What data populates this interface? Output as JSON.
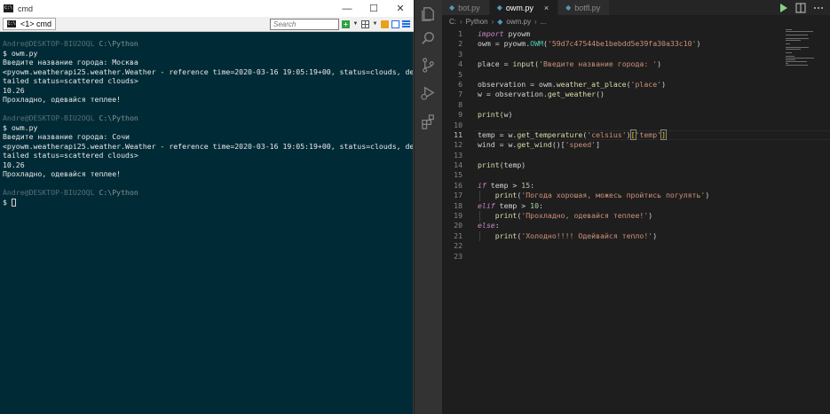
{
  "cmder": {
    "title": "cmd",
    "title_icon": "cmder-icon",
    "window_buttons": [
      "—",
      "☐",
      "✕"
    ],
    "tab_label": "<1> cmd",
    "search_placeholder": "Search",
    "prompt_user": "Andre@DESKTOP-BIU2OQL",
    "prompt_path": "C:\\Python",
    "lines": [
      {
        "type": "prompt"
      },
      {
        "type": "text",
        "text": "$ owm.py"
      },
      {
        "type": "text",
        "text": "Введите название города: Москва"
      },
      {
        "type": "text",
        "text": "<pyowm.weatherapi25.weather.Weather - reference time=2020-03-16 19:05:19+00, status=clouds, de"
      },
      {
        "type": "text",
        "text": "tailed status=scattered clouds>"
      },
      {
        "type": "text",
        "text": "10.26"
      },
      {
        "type": "text",
        "text": "Прохладно, одевайся теплее!"
      },
      {
        "type": "text",
        "text": ""
      },
      {
        "type": "prompt"
      },
      {
        "type": "text",
        "text": "$ owm.py"
      },
      {
        "type": "text",
        "text": "Введите название города: Сочи"
      },
      {
        "type": "text",
        "text": "<pyowm.weatherapi25.weather.Weather - reference time=2020-03-16 19:05:19+00, status=clouds, de"
      },
      {
        "type": "text",
        "text": "tailed status=scattered clouds>"
      },
      {
        "type": "text",
        "text": "10.26"
      },
      {
        "type": "text",
        "text": "Прохладно, одевайся теплее!"
      },
      {
        "type": "text",
        "text": ""
      },
      {
        "type": "prompt"
      },
      {
        "type": "cursor",
        "text": "$ "
      }
    ]
  },
  "vscode": {
    "tabs": [
      {
        "label": "bot.py",
        "active": false
      },
      {
        "label": "owm.py",
        "active": true
      },
      {
        "label": "botfl.py",
        "active": false
      }
    ],
    "tab_close": "×",
    "breadcrumb": [
      "C:",
      "Python",
      "owm.py",
      "..."
    ],
    "activity_icons": [
      "files-icon",
      "search-icon",
      "source-control-icon",
      "run-debug-icon",
      "extensions-icon"
    ],
    "editor_actions": [
      "run-icon",
      "split-editor-icon",
      "more-actions-icon"
    ],
    "current_line": 11,
    "code": [
      {
        "n": "1",
        "html": "<span class=\"kw\">import</span> pyowm"
      },
      {
        "n": "2",
        "html": "owm = pyowm.<span class=\"cls\">OWM</span>(<span class=\"st\">'59d7c47544be1bebdd5e39fa30a33c10'</span>)"
      },
      {
        "n": "3",
        "html": ""
      },
      {
        "n": "4",
        "html": "place = <span class=\"fn\">input</span>(<span class=\"st\">'Введите название города: '</span>)"
      },
      {
        "n": "5",
        "html": ""
      },
      {
        "n": "6",
        "html": "observation = owm.<span class=\"fn\">weather_at_place</span>(<span class=\"st\">'place'</span>)"
      },
      {
        "n": "7",
        "html": "w = observation.<span class=\"fn\">get_weather</span>()"
      },
      {
        "n": "8",
        "html": ""
      },
      {
        "n": "9",
        "html": "<span class=\"fn\">print</span>(w)"
      },
      {
        "n": "10",
        "html": ""
      },
      {
        "n": "11",
        "html": "temp = w.<span class=\"fn\">get_temperature</span>(<span class=\"st\">'celsius'</span>)<span class=\"bk bkm\">[</span><span class=\"st\">'temp'</span><span class=\"bk bkm\">]</span>"
      },
      {
        "n": "12",
        "html": "wind = w.<span class=\"fn\">get_wind</span>()[<span class=\"st\">'speed'</span>]"
      },
      {
        "n": "13",
        "html": ""
      },
      {
        "n": "14",
        "html": "<span class=\"fn\">print</span>(temp)"
      },
      {
        "n": "15",
        "html": ""
      },
      {
        "n": "16",
        "html": "<span class=\"kw\">if</span> temp &gt; <span class=\"nm\">15</span>:"
      },
      {
        "n": "17",
        "html": "    <span class=\"fn\">print</span>(<span class=\"st\">'Погода хорошая, можесь пройтись погулять'</span>)"
      },
      {
        "n": "18",
        "html": "<span class=\"kw\">elif</span> temp &gt; <span class=\"nm\">10</span>:"
      },
      {
        "n": "19",
        "html": "    <span class=\"fn\">print</span>(<span class=\"st\">'Прохладно, одевайся теплее!'</span>)"
      },
      {
        "n": "20",
        "html": "<span class=\"kw\">else</span>:"
      },
      {
        "n": "21",
        "html": "    <span class=\"fn\">print</span>(<span class=\"st\">'Холодно!!!! Одейвайся тепло!'</span>)"
      },
      {
        "n": "22",
        "html": ""
      },
      {
        "n": "23",
        "html": ""
      }
    ]
  }
}
